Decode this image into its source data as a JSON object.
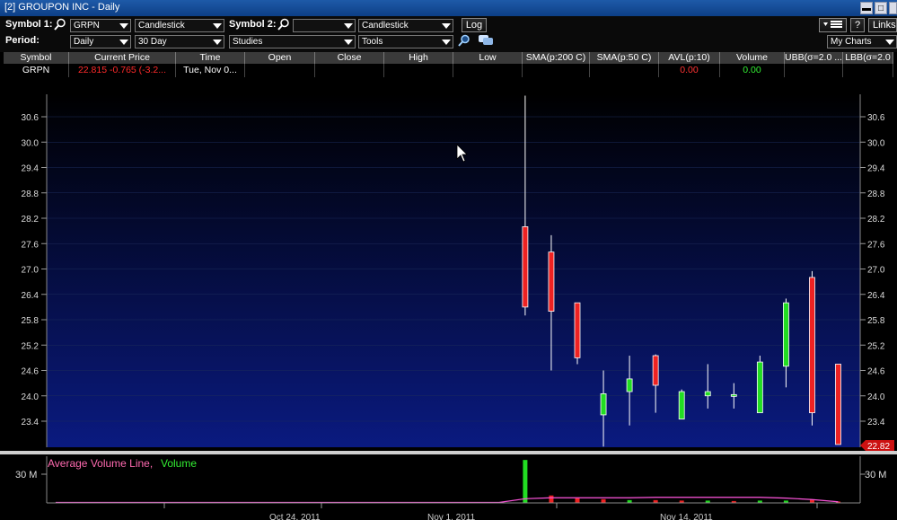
{
  "window": {
    "title": "[2] GROUPON INC - Daily"
  },
  "toolbar": {
    "symbol1_label": "Symbol 1:",
    "symbol1_value": "GRPN",
    "chart_type1": "Candlestick",
    "symbol2_label": "Symbol 2:",
    "symbol2_value": "",
    "chart_type2": "Candlestick",
    "log_label": "Log",
    "period_label": "Period:",
    "period_value": "Daily",
    "range_value": "30 Day",
    "studies_value": "Studies",
    "tools_value": "Tools",
    "help_label": "?",
    "links_label": "Links",
    "mycharts_value": "My Charts"
  },
  "table": {
    "headers": [
      "Symbol",
      "Current Price",
      "Time",
      "Open",
      "Close",
      "High",
      "Low",
      "SMA(p:200 C)",
      "SMA(p:50 C)",
      "AVL(p:10)",
      "Volume",
      "UBB(σ=2.0 ...",
      "LBB(σ=2.0"
    ],
    "row": {
      "symbol": "GRPN",
      "current_price": "22.815 -0.765 (-3.2...",
      "time": "Tue, Nov 0...",
      "open": "",
      "close": "",
      "high": "",
      "low": "",
      "sma200": "",
      "sma50": "",
      "avl": "0.00",
      "volume": "0.00",
      "ubb": "",
      "lbb": ""
    }
  },
  "colors": {
    "up": "#22dd22",
    "down": "#ee2222",
    "price_tag": "#cc1111",
    "avg_line": "#ff55dd"
  },
  "chart_data": [
    {
      "type": "candlestick",
      "ylim": [
        22.82,
        31.0
      ],
      "yticks": [
        23.4,
        24.0,
        24.6,
        25.2,
        25.8,
        26.4,
        27.0,
        27.6,
        28.2,
        28.8,
        29.4,
        30.0,
        30.6
      ],
      "ytick_labels": [
        "23.4",
        "24.0",
        "24.6",
        "25.2",
        "25.8",
        "26.4",
        "27.0",
        "27.6",
        "28.2",
        "28.8",
        "29.4",
        "30.0",
        "30.6"
      ],
      "current_price_label": "22.82",
      "candles": [
        {
          "i": 18,
          "open": 28.0,
          "close": 26.1,
          "high": 31.1,
          "low": 25.9
        },
        {
          "i": 19,
          "open": 27.4,
          "close": 26.0,
          "high": 27.8,
          "low": 24.6
        },
        {
          "i": 20,
          "open": 26.2,
          "close": 24.9,
          "high": 26.2,
          "low": 24.75
        },
        {
          "i": 21,
          "open": 23.55,
          "close": 24.05,
          "high": 24.6,
          "low": 22.8
        },
        {
          "i": 22,
          "open": 24.1,
          "close": 24.4,
          "high": 24.95,
          "low": 23.3
        },
        {
          "i": 23,
          "open": 24.95,
          "close": 24.25,
          "high": 24.98,
          "low": 23.6
        },
        {
          "i": 24,
          "open": 23.45,
          "close": 24.1,
          "high": 24.15,
          "low": 23.45
        },
        {
          "i": 25,
          "open": 24.0,
          "close": 24.1,
          "high": 24.75,
          "low": 23.7
        },
        {
          "i": 26,
          "open": 24.03,
          "close": 24.03,
          "high": 24.3,
          "low": 23.7
        },
        {
          "i": 27,
          "open": 23.6,
          "close": 24.8,
          "high": 24.95,
          "low": 23.6
        },
        {
          "i": 28,
          "open": 24.7,
          "close": 26.2,
          "high": 26.3,
          "low": 24.2
        },
        {
          "i": 29,
          "open": 26.8,
          "close": 23.6,
          "high": 26.95,
          "low": 23.3
        },
        {
          "i": 30,
          "open": 24.75,
          "close": 22.85,
          "high": 24.75,
          "low": 22.85
        }
      ]
    },
    {
      "type": "bar",
      "legend": [
        "Average Volume Line,",
        "Volume"
      ],
      "ylabel_tick": "30 M",
      "ylim": [
        0,
        50
      ],
      "volumes": [
        {
          "i": 18,
          "value": 46.0,
          "up": true
        },
        {
          "i": 19,
          "value": 8.0,
          "up": false
        },
        {
          "i": 20,
          "value": 5.0,
          "up": false
        },
        {
          "i": 21,
          "value": 4.0,
          "up": false
        },
        {
          "i": 22,
          "value": 3.0,
          "up": true
        },
        {
          "i": 23,
          "value": 3.0,
          "up": false
        },
        {
          "i": 24,
          "value": 2.5,
          "up": false
        },
        {
          "i": 25,
          "value": 2.5,
          "up": true
        },
        {
          "i": 26,
          "value": 2.0,
          "up": false
        },
        {
          "i": 27,
          "value": 2.5,
          "up": true
        },
        {
          "i": 28,
          "value": 2.5,
          "up": true
        },
        {
          "i": 29,
          "value": 3.5,
          "up": false
        },
        {
          "i": 30,
          "value": 1.5,
          "up": false
        }
      ],
      "avg_line": [
        {
          "i": 0,
          "value": 0.5
        },
        {
          "i": 17,
          "value": 0.5
        },
        {
          "i": 18,
          "value": 4.5
        },
        {
          "i": 19,
          "value": 5.5
        },
        {
          "i": 22,
          "value": 5.5
        },
        {
          "i": 23,
          "value": 6.0
        },
        {
          "i": 27,
          "value": 6.0
        },
        {
          "i": 28,
          "value": 5.2
        },
        {
          "i": 29,
          "value": 3.6
        },
        {
          "i": 30,
          "value": 1.2
        }
      ],
      "xtick_labels": [
        "Oct 24, 2011",
        "Nov 1, 2011",
        "Nov 14, 2011"
      ]
    }
  ]
}
